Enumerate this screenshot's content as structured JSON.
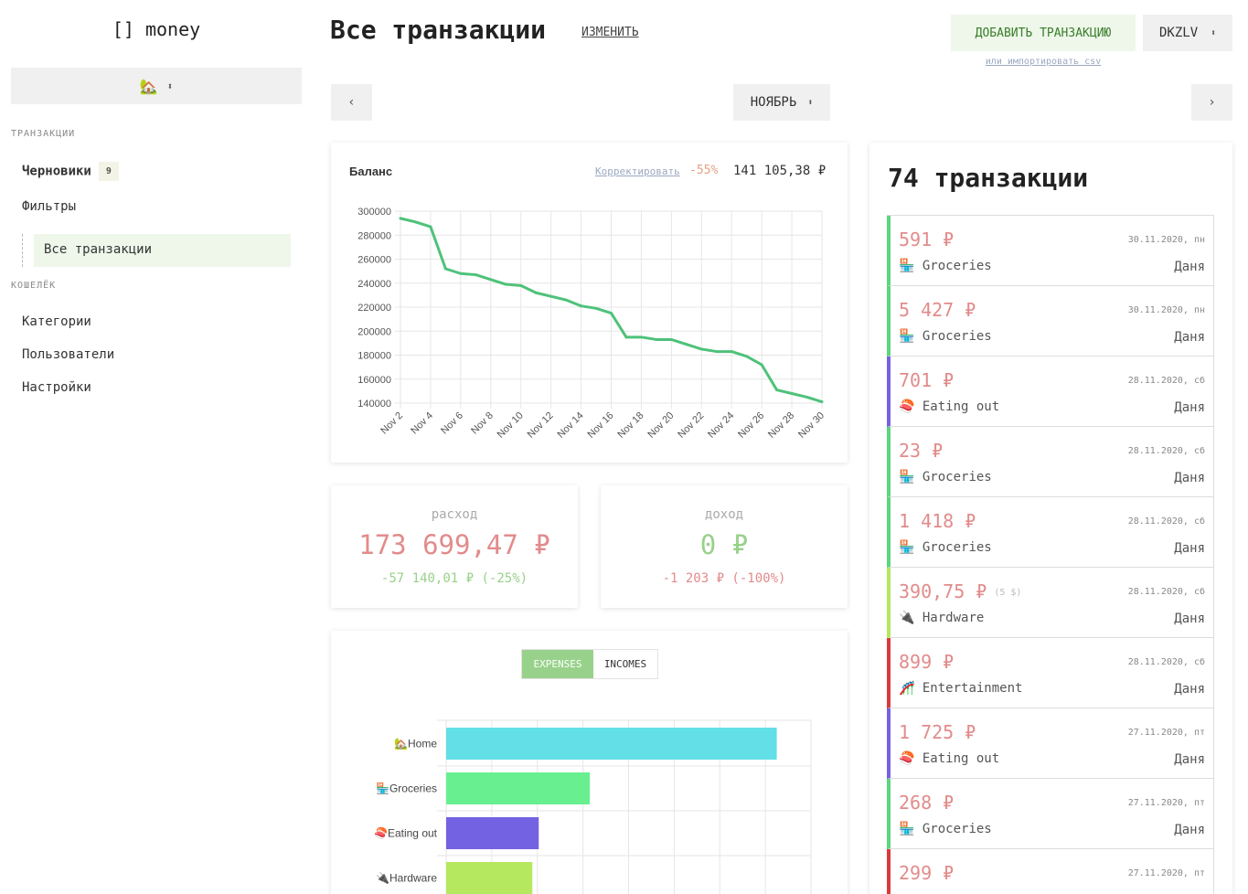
{
  "sidebar": {
    "logo": "[] money",
    "wallet_icon": "🏡",
    "section_transactions": "ТРАНЗАКЦИИ",
    "drafts_label": "Черновики",
    "drafts_count": "9",
    "filters_label": "Фильтры",
    "all_transactions": "Все транзакции",
    "section_wallet": "КОШЕЛЁК",
    "categories": "Категории",
    "users": "Пользователи",
    "settings": "Настройки"
  },
  "header": {
    "title": "Все транзакции",
    "edit": "ИЗМЕНИТЬ",
    "add_transaction": "ДОБАВИТЬ ТРАНЗАКЦИЮ",
    "import_csv": "или импортировать csv",
    "currency": "DKZLV",
    "prev": "‹",
    "next": "›",
    "month": "НОЯБРЬ"
  },
  "balance": {
    "title": "Баланс",
    "correct": "Корректировать",
    "change": "-55%",
    "value": "141 105,38 ₽"
  },
  "expense": {
    "label": "расход",
    "value": "173 699,47 ₽",
    "diff": "-57 140,01 ₽ (-25%)"
  },
  "income": {
    "label": "доход",
    "value": "0 ₽",
    "diff": "-1 203 ₽ (-100%)"
  },
  "category_tabs": {
    "expenses": "EXPENSES",
    "incomes": "INCOMES"
  },
  "chart_data": [
    {
      "type": "line",
      "title": "Баланс",
      "x": [
        "Nov 2",
        "Nov 3",
        "Nov 4",
        "Nov 5",
        "Nov 6",
        "Nov 7",
        "Nov 8",
        "Nov 9",
        "Nov 10",
        "Nov 11",
        "Nov 12",
        "Nov 13",
        "Nov 14",
        "Nov 15",
        "Nov 16",
        "Nov 17",
        "Nov 18",
        "Nov 19",
        "Nov 20",
        "Nov 21",
        "Nov 22",
        "Nov 23",
        "Nov 24",
        "Nov 25",
        "Nov 26",
        "Nov 27",
        "Nov 28",
        "Nov 29",
        "Nov 30"
      ],
      "x_tick_labels": [
        "Nov 2",
        "Nov 4",
        "Nov 6",
        "Nov 8",
        "Nov 10",
        "Nov 12",
        "Nov 14",
        "Nov 16",
        "Nov 18",
        "Nov 20",
        "Nov 22",
        "Nov 24",
        "Nov 26",
        "Nov 28",
        "Nov 30"
      ],
      "values": [
        294000,
        291000,
        287000,
        252000,
        248000,
        247000,
        243000,
        239000,
        238000,
        232000,
        229000,
        226000,
        221000,
        219000,
        215000,
        195000,
        195000,
        193000,
        193000,
        189000,
        185000,
        183000,
        183000,
        179000,
        172000,
        151000,
        148000,
        145000,
        141105
      ],
      "ylim": [
        140000,
        300000
      ],
      "y_ticks": [
        140000,
        160000,
        180000,
        200000,
        220000,
        240000,
        260000,
        280000,
        300000
      ],
      "color": "#4ec27a",
      "grid": true
    },
    {
      "type": "bar",
      "orientation": "horizontal",
      "categories": [
        "🏡Home",
        "🏪Groceries",
        "🍣Eating out",
        "🔌Hardware"
      ],
      "values": [
        72500,
        31500,
        20300,
        18900
      ],
      "colors": [
        "#63dfe8",
        "#68ef90",
        "#7362e2",
        "#b5e85f"
      ],
      "xlim": [
        0,
        80000
      ],
      "grid": true
    }
  ],
  "transactions": {
    "count_label": "74 транзакции",
    "items": [
      {
        "amount": "591 ₽",
        "orig": "",
        "date": "30.11.2020, пн",
        "icon": "🏪",
        "category": "Groceries",
        "user": "Даня",
        "color": "#5cd67d"
      },
      {
        "amount": "5 427 ₽",
        "orig": "",
        "date": "30.11.2020, пн",
        "icon": "🏪",
        "category": "Groceries",
        "user": "Даня",
        "color": "#5cd67d"
      },
      {
        "amount": "701 ₽",
        "orig": "",
        "date": "28.11.2020, сб",
        "icon": "🍣",
        "category": "Eating out",
        "user": "Даня",
        "color": "#7362e2"
      },
      {
        "amount": "23 ₽",
        "orig": "",
        "date": "28.11.2020, сб",
        "icon": "🏪",
        "category": "Groceries",
        "user": "Даня",
        "color": "#5cd67d"
      },
      {
        "amount": "1 418 ₽",
        "orig": "",
        "date": "28.11.2020, сб",
        "icon": "🏪",
        "category": "Groceries",
        "user": "Даня",
        "color": "#5cd67d"
      },
      {
        "amount": "390,75 ₽",
        "orig": "(5 $)",
        "date": "28.11.2020, сб",
        "icon": "🔌",
        "category": "Hardware",
        "user": "Даня",
        "color": "#b5e85f"
      },
      {
        "amount": "899 ₽",
        "orig": "",
        "date": "28.11.2020, сб",
        "icon": "🎢",
        "category": "Entertainment",
        "user": "Даня",
        "color": "#d93b3b"
      },
      {
        "amount": "1 725 ₽",
        "orig": "",
        "date": "27.11.2020, пт",
        "icon": "🍣",
        "category": "Eating out",
        "user": "Даня",
        "color": "#7362e2"
      },
      {
        "amount": "268 ₽",
        "orig": "",
        "date": "27.11.2020, пт",
        "icon": "🏪",
        "category": "Groceries",
        "user": "Даня",
        "color": "#5cd67d"
      },
      {
        "amount": "299 ₽",
        "orig": "",
        "date": "27.11.2020, пт",
        "icon": "",
        "category": "",
        "user": "",
        "color": "#d93b3b"
      }
    ]
  }
}
